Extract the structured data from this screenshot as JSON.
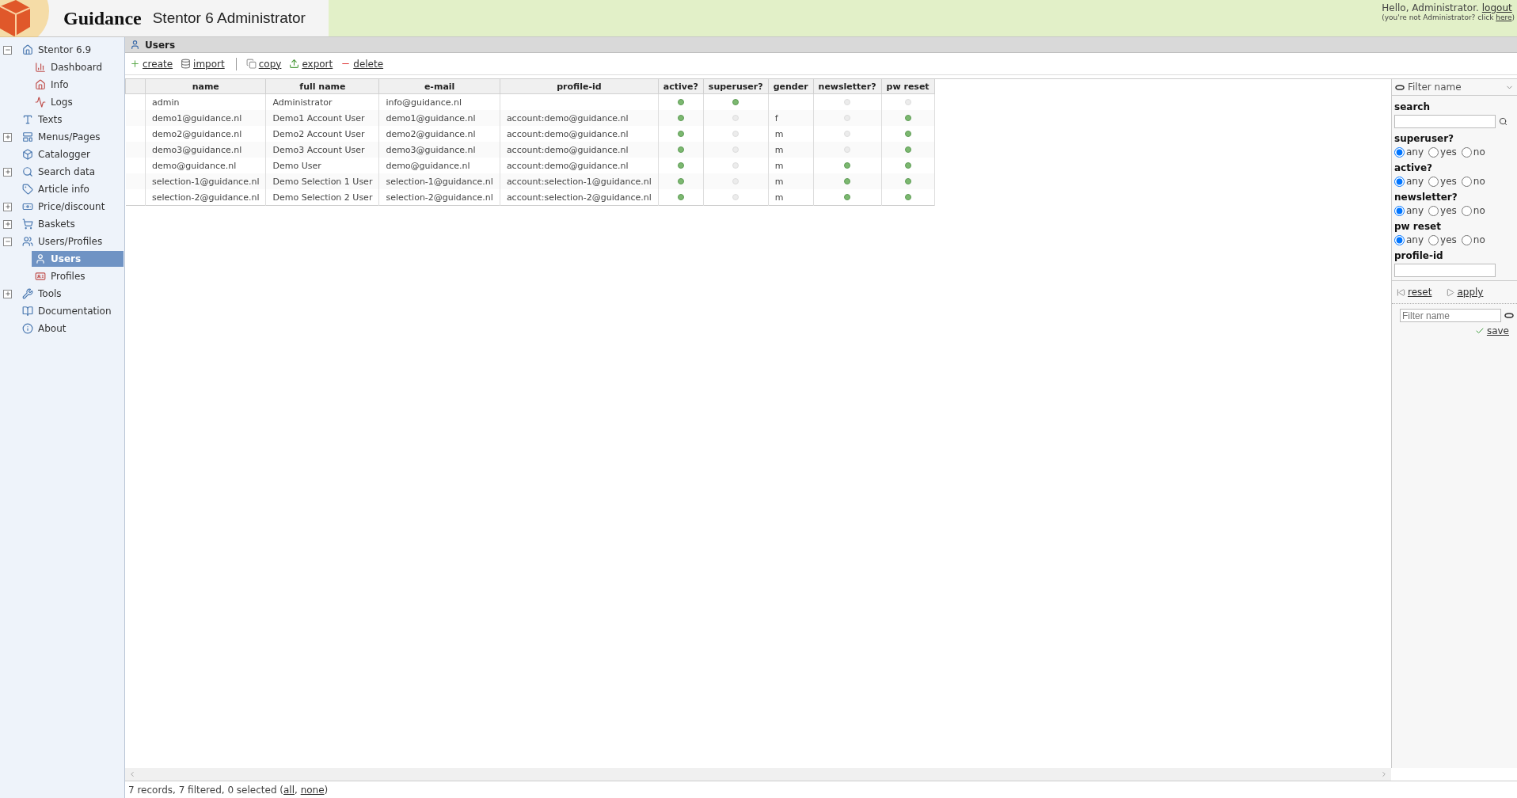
{
  "header": {
    "brand": "Guidance",
    "product": "Stentor 6 Administrator",
    "greeting": "Hello, Administrator.",
    "logout": "logout",
    "hint_prefix": "(you're not Administrator? click ",
    "hint_link": "here",
    "hint_suffix": ")"
  },
  "sidebar": {
    "items": [
      {
        "label": "Stentor 6.9",
        "expanded": true,
        "selected": false,
        "children": [
          {
            "label": "Dashboard",
            "selected": false
          },
          {
            "label": "Info",
            "selected": false
          },
          {
            "label": "Logs",
            "selected": false
          }
        ]
      },
      {
        "label": "Texts",
        "selected": false
      },
      {
        "label": "Menus/Pages",
        "expanded": false,
        "selected": false
      },
      {
        "label": "Catalogger",
        "selected": false
      },
      {
        "label": "Search data",
        "expanded": false,
        "selected": false
      },
      {
        "label": "Article info",
        "selected": false
      },
      {
        "label": "Price/discount",
        "expanded": false,
        "selected": false
      },
      {
        "label": "Baskets",
        "expanded": false,
        "selected": false
      },
      {
        "label": "Users/Profiles",
        "expanded": true,
        "selected": false,
        "children": [
          {
            "label": "Users",
            "selected": true
          },
          {
            "label": "Profiles",
            "selected": false
          }
        ]
      },
      {
        "label": "Tools",
        "expanded": false,
        "selected": false
      },
      {
        "label": "Documentation",
        "selected": false
      },
      {
        "label": "About",
        "selected": false
      }
    ]
  },
  "page_title": "Users",
  "toolbar": [
    {
      "label": "create",
      "kind": "create"
    },
    {
      "label": "import",
      "kind": "import"
    },
    {
      "label": "copy",
      "kind": "copy",
      "separator_before": true
    },
    {
      "label": "export",
      "kind": "export"
    },
    {
      "label": "delete",
      "kind": "delete"
    }
  ],
  "table": {
    "columns": [
      {
        "label": "name",
        "kind": "text"
      },
      {
        "label": "full name",
        "kind": "text"
      },
      {
        "label": "e-mail",
        "kind": "text"
      },
      {
        "label": "profile-id",
        "kind": "text"
      },
      {
        "label": "active?",
        "kind": "flag"
      },
      {
        "label": "superuser?",
        "kind": "flag"
      },
      {
        "label": "gender",
        "kind": "text"
      },
      {
        "label": "newsletter?",
        "kind": "flag"
      },
      {
        "label": "pw reset",
        "kind": "flag"
      }
    ],
    "rows": [
      {
        "selected": false,
        "cells": [
          "admin",
          "Administrator",
          "info@guidance.nl",
          null,
          true,
          true,
          null,
          false,
          false
        ]
      },
      {
        "selected": false,
        "cells": [
          "demo1@guidance.nl",
          "Demo1 Account User",
          "demo1@guidance.nl",
          "account:demo@guidance.nl",
          true,
          false,
          "f",
          false,
          true
        ]
      },
      {
        "selected": false,
        "cells": [
          "demo2@guidance.nl",
          "Demo2 Account User",
          "demo2@guidance.nl",
          "account:demo@guidance.nl",
          true,
          false,
          "m",
          false,
          true
        ]
      },
      {
        "selected": false,
        "cells": [
          "demo3@guidance.nl",
          "Demo3 Account User",
          "demo3@guidance.nl",
          "account:demo@guidance.nl",
          true,
          false,
          "m",
          false,
          true
        ]
      },
      {
        "selected": false,
        "cells": [
          "demo@guidance.nl",
          "Demo User",
          "demo@guidance.nl",
          "account:demo@guidance.nl",
          true,
          false,
          "m",
          true,
          true
        ]
      },
      {
        "selected": false,
        "cells": [
          "selection-1@guidance.nl",
          "Demo Selection 1 User",
          "selection-1@guidance.nl",
          "account:selection-1@guidance.nl",
          true,
          false,
          "m",
          true,
          true
        ]
      },
      {
        "selected": false,
        "cells": [
          "selection-2@guidance.nl",
          "Demo Selection 2 User",
          "selection-2@guidance.nl",
          "account:selection-2@guidance.nl",
          true,
          false,
          "m",
          true,
          true
        ]
      }
    ]
  },
  "filter_panel": {
    "title": "Filter name",
    "filters": [
      {
        "kind": "text",
        "label": "search"
      },
      {
        "kind": "radio",
        "label": "superuser?",
        "options": [
          {
            "label": "any",
            "selected": true
          },
          {
            "label": "yes",
            "selected": false
          },
          {
            "label": "no",
            "selected": false
          }
        ]
      },
      {
        "kind": "radio",
        "label": "active?",
        "options": [
          {
            "label": "any",
            "selected": true
          },
          {
            "label": "yes",
            "selected": false
          },
          {
            "label": "no",
            "selected": false
          }
        ]
      },
      {
        "kind": "radio",
        "label": "newsletter?",
        "options": [
          {
            "label": "any",
            "selected": true
          },
          {
            "label": "yes",
            "selected": false
          },
          {
            "label": "no",
            "selected": false
          }
        ]
      },
      {
        "kind": "radio",
        "label": "pw reset",
        "options": [
          {
            "label": "any",
            "selected": true
          },
          {
            "label": "yes",
            "selected": false
          },
          {
            "label": "no",
            "selected": false
          }
        ]
      },
      {
        "kind": "field",
        "label": "profile-id"
      }
    ],
    "reset": "reset",
    "apply": "apply",
    "name_placeholder": "Filter name",
    "save": "save"
  },
  "status": {
    "text": "7 records, 7 filtered, 0 selected (",
    "all": "all",
    "sep": ", ",
    "none": "none",
    "end": ")"
  }
}
